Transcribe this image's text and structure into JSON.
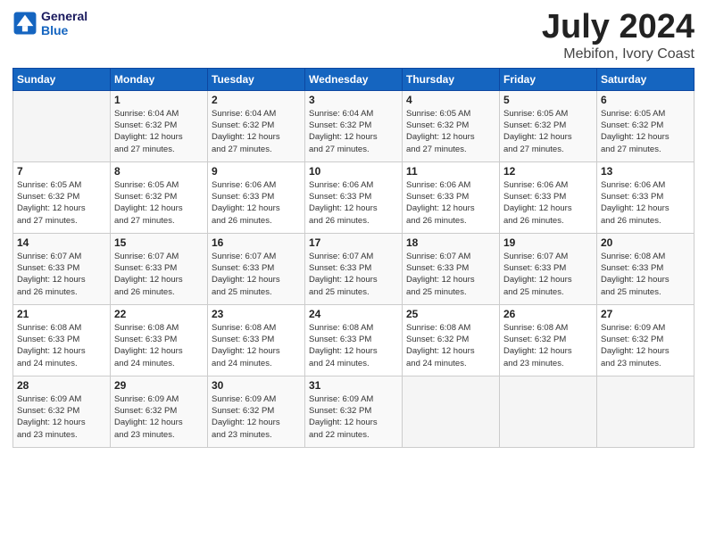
{
  "header": {
    "logo_line1": "General",
    "logo_line2": "Blue",
    "month": "July 2024",
    "location": "Mebifon, Ivory Coast"
  },
  "weekdays": [
    "Sunday",
    "Monday",
    "Tuesday",
    "Wednesday",
    "Thursday",
    "Friday",
    "Saturday"
  ],
  "weeks": [
    [
      {
        "day": "",
        "detail": ""
      },
      {
        "day": "1",
        "detail": "Sunrise: 6:04 AM\nSunset: 6:32 PM\nDaylight: 12 hours\nand 27 minutes."
      },
      {
        "day": "2",
        "detail": "Sunrise: 6:04 AM\nSunset: 6:32 PM\nDaylight: 12 hours\nand 27 minutes."
      },
      {
        "day": "3",
        "detail": "Sunrise: 6:04 AM\nSunset: 6:32 PM\nDaylight: 12 hours\nand 27 minutes."
      },
      {
        "day": "4",
        "detail": "Sunrise: 6:05 AM\nSunset: 6:32 PM\nDaylight: 12 hours\nand 27 minutes."
      },
      {
        "day": "5",
        "detail": "Sunrise: 6:05 AM\nSunset: 6:32 PM\nDaylight: 12 hours\nand 27 minutes."
      },
      {
        "day": "6",
        "detail": "Sunrise: 6:05 AM\nSunset: 6:32 PM\nDaylight: 12 hours\nand 27 minutes."
      }
    ],
    [
      {
        "day": "7",
        "detail": "Sunrise: 6:05 AM\nSunset: 6:32 PM\nDaylight: 12 hours\nand 27 minutes."
      },
      {
        "day": "8",
        "detail": "Sunrise: 6:05 AM\nSunset: 6:32 PM\nDaylight: 12 hours\nand 27 minutes."
      },
      {
        "day": "9",
        "detail": "Sunrise: 6:06 AM\nSunset: 6:33 PM\nDaylight: 12 hours\nand 26 minutes."
      },
      {
        "day": "10",
        "detail": "Sunrise: 6:06 AM\nSunset: 6:33 PM\nDaylight: 12 hours\nand 26 minutes."
      },
      {
        "day": "11",
        "detail": "Sunrise: 6:06 AM\nSunset: 6:33 PM\nDaylight: 12 hours\nand 26 minutes."
      },
      {
        "day": "12",
        "detail": "Sunrise: 6:06 AM\nSunset: 6:33 PM\nDaylight: 12 hours\nand 26 minutes."
      },
      {
        "day": "13",
        "detail": "Sunrise: 6:06 AM\nSunset: 6:33 PM\nDaylight: 12 hours\nand 26 minutes."
      }
    ],
    [
      {
        "day": "14",
        "detail": "Sunrise: 6:07 AM\nSunset: 6:33 PM\nDaylight: 12 hours\nand 26 minutes."
      },
      {
        "day": "15",
        "detail": "Sunrise: 6:07 AM\nSunset: 6:33 PM\nDaylight: 12 hours\nand 26 minutes."
      },
      {
        "day": "16",
        "detail": "Sunrise: 6:07 AM\nSunset: 6:33 PM\nDaylight: 12 hours\nand 25 minutes."
      },
      {
        "day": "17",
        "detail": "Sunrise: 6:07 AM\nSunset: 6:33 PM\nDaylight: 12 hours\nand 25 minutes."
      },
      {
        "day": "18",
        "detail": "Sunrise: 6:07 AM\nSunset: 6:33 PM\nDaylight: 12 hours\nand 25 minutes."
      },
      {
        "day": "19",
        "detail": "Sunrise: 6:07 AM\nSunset: 6:33 PM\nDaylight: 12 hours\nand 25 minutes."
      },
      {
        "day": "20",
        "detail": "Sunrise: 6:08 AM\nSunset: 6:33 PM\nDaylight: 12 hours\nand 25 minutes."
      }
    ],
    [
      {
        "day": "21",
        "detail": "Sunrise: 6:08 AM\nSunset: 6:33 PM\nDaylight: 12 hours\nand 24 minutes."
      },
      {
        "day": "22",
        "detail": "Sunrise: 6:08 AM\nSunset: 6:33 PM\nDaylight: 12 hours\nand 24 minutes."
      },
      {
        "day": "23",
        "detail": "Sunrise: 6:08 AM\nSunset: 6:33 PM\nDaylight: 12 hours\nand 24 minutes."
      },
      {
        "day": "24",
        "detail": "Sunrise: 6:08 AM\nSunset: 6:33 PM\nDaylight: 12 hours\nand 24 minutes."
      },
      {
        "day": "25",
        "detail": "Sunrise: 6:08 AM\nSunset: 6:32 PM\nDaylight: 12 hours\nand 24 minutes."
      },
      {
        "day": "26",
        "detail": "Sunrise: 6:08 AM\nSunset: 6:32 PM\nDaylight: 12 hours\nand 23 minutes."
      },
      {
        "day": "27",
        "detail": "Sunrise: 6:09 AM\nSunset: 6:32 PM\nDaylight: 12 hours\nand 23 minutes."
      }
    ],
    [
      {
        "day": "28",
        "detail": "Sunrise: 6:09 AM\nSunset: 6:32 PM\nDaylight: 12 hours\nand 23 minutes."
      },
      {
        "day": "29",
        "detail": "Sunrise: 6:09 AM\nSunset: 6:32 PM\nDaylight: 12 hours\nand 23 minutes."
      },
      {
        "day": "30",
        "detail": "Sunrise: 6:09 AM\nSunset: 6:32 PM\nDaylight: 12 hours\nand 23 minutes."
      },
      {
        "day": "31",
        "detail": "Sunrise: 6:09 AM\nSunset: 6:32 PM\nDaylight: 12 hours\nand 22 minutes."
      },
      {
        "day": "",
        "detail": ""
      },
      {
        "day": "",
        "detail": ""
      },
      {
        "day": "",
        "detail": ""
      }
    ]
  ]
}
